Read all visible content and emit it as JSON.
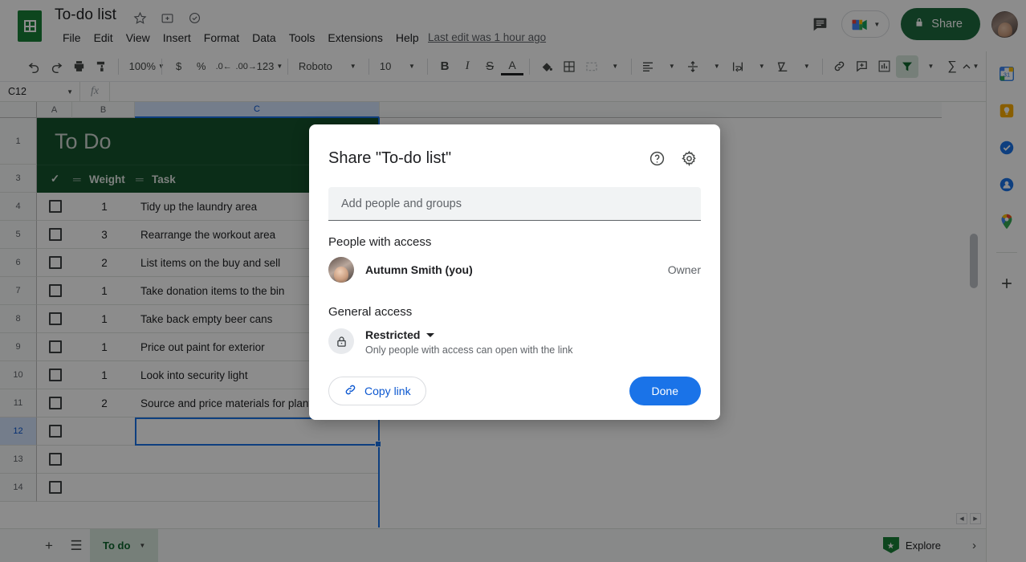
{
  "app": {
    "name": "Google Sheets",
    "doc_title": "To-do list",
    "last_edit": "Last edit was 1 hour ago"
  },
  "title_bar": {
    "icons": [
      {
        "name": "star-icon",
        "glyph": "☆"
      },
      {
        "name": "move-to-folder-icon",
        "glyph": "❐"
      },
      {
        "name": "cloud-saved-icon",
        "glyph": "☁"
      }
    ],
    "menu": [
      "File",
      "Edit",
      "View",
      "Insert",
      "Format",
      "Data",
      "Tools",
      "Extensions",
      "Help"
    ],
    "comment_icon": "comment-history-icon",
    "meet_icon": "google-meet-icon",
    "share_label": "Share",
    "share_color": "#1e6b3f",
    "avatar_name": "account-avatar"
  },
  "toolbar": {
    "zoom": "100%",
    "font": "Roboto",
    "font_size": "10",
    "number_format": "123",
    "items": [
      {
        "name": "undo-icon",
        "glyph": "↶"
      },
      {
        "name": "redo-icon",
        "glyph": "↷"
      },
      {
        "name": "print-icon",
        "glyph": "⎙"
      },
      {
        "name": "paint-format-icon",
        "glyph": "✐"
      },
      {
        "name": "currency-icon",
        "glyph": "$"
      },
      {
        "name": "percent-icon",
        "glyph": "%"
      },
      {
        "name": "decrease-decimal-icon",
        "glyph": ".0"
      },
      {
        "name": "increase-decimal-icon",
        "glyph": ".00"
      },
      {
        "name": "bold-icon",
        "glyph": "B"
      },
      {
        "name": "italic-icon",
        "glyph": "I"
      },
      {
        "name": "strikethrough-icon",
        "glyph": "S"
      },
      {
        "name": "text-color-icon",
        "glyph": "A"
      },
      {
        "name": "fill-color-icon",
        "glyph": "◆"
      },
      {
        "name": "borders-icon",
        "glyph": "⊞"
      },
      {
        "name": "merge-cells-icon",
        "glyph": "⬚"
      },
      {
        "name": "horizontal-align-icon",
        "glyph": "☰"
      },
      {
        "name": "vertical-align-icon",
        "glyph": "⩒"
      },
      {
        "name": "text-wrap-icon",
        "glyph": "↵"
      },
      {
        "name": "text-rotation-icon",
        "glyph": "▽"
      },
      {
        "name": "insert-link-icon",
        "glyph": "⚭"
      },
      {
        "name": "insert-comment-icon",
        "glyph": "⊞"
      },
      {
        "name": "insert-chart-icon",
        "glyph": "Ὄa"
      },
      {
        "name": "filter-icon",
        "glyph": "▼"
      },
      {
        "name": "functions-icon",
        "glyph": "Σ"
      },
      {
        "name": "collapse-toolbar-icon",
        "glyph": "∧"
      }
    ]
  },
  "formula_bar": {
    "cell_reference": "C12",
    "fx_label": "fx",
    "formula_value": ""
  },
  "grid": {
    "columns": [
      "A",
      "B",
      "C"
    ],
    "selected_column": "C",
    "selected_cell": "C12",
    "sheet_header": {
      "title": "To Do",
      "col_check": "✓",
      "col_weight": "Weight",
      "col_task": "Task",
      "background": "#14532d"
    },
    "row_numbers": [
      "1",
      "3",
      "4",
      "5",
      "6",
      "7",
      "8",
      "9",
      "10",
      "11",
      "12",
      "13",
      "14"
    ],
    "rows": [
      {
        "row": "4",
        "checked": false,
        "weight": "1",
        "task": "Tidy up the laundry area"
      },
      {
        "row": "5",
        "checked": false,
        "weight": "3",
        "task": "Rearrange the workout area"
      },
      {
        "row": "6",
        "checked": false,
        "weight": "2",
        "task": "List items on the buy and sell"
      },
      {
        "row": "7",
        "checked": false,
        "weight": "1",
        "task": "Take donation items to the bin"
      },
      {
        "row": "8",
        "checked": false,
        "weight": "1",
        "task": "Take back empty beer cans"
      },
      {
        "row": "9",
        "checked": false,
        "weight": "1",
        "task": "Price out paint for exterior"
      },
      {
        "row": "10",
        "checked": false,
        "weight": "1",
        "task": "Look into security light"
      },
      {
        "row": "11",
        "checked": false,
        "weight": "2",
        "task": "Source and price materials for plant"
      },
      {
        "row": "12",
        "checked": false,
        "weight": "",
        "task": ""
      },
      {
        "row": "13",
        "checked": false,
        "weight": "",
        "task": ""
      },
      {
        "row": "14",
        "checked": false,
        "weight": "",
        "task": ""
      }
    ]
  },
  "sheet_bar": {
    "add_sheet_icon": "+",
    "all_sheets_icon": "☰",
    "tabs": [
      {
        "label": "To do",
        "active": true
      }
    ],
    "explore_label": "Explore",
    "expand_icon": "›"
  },
  "side_panel": {
    "items": [
      {
        "name": "google-calendar-icon",
        "label": "31",
        "color": "#1a73e8"
      },
      {
        "name": "google-keep-icon",
        "label": "",
        "color": "#f9ab00"
      },
      {
        "name": "google-tasks-icon",
        "label": "",
        "color": "#1a73e8"
      },
      {
        "name": "google-contacts-icon",
        "label": "",
        "color": "#1a73e8"
      },
      {
        "name": "google-maps-icon",
        "label": "",
        "color": "#34a853"
      },
      {
        "name": "add-apps-icon",
        "label": "+",
        "color": "#444746"
      }
    ]
  },
  "share_dialog": {
    "title": "Share \"To-do list\"",
    "help_icon": "help-icon",
    "settings_icon": "settings-gear-icon",
    "add_people_placeholder": "Add people and groups",
    "people_section_title": "People with access",
    "people": [
      {
        "name": "Autumn Smith (you)",
        "role": "Owner"
      }
    ],
    "general_access_title": "General access",
    "access_value": "Restricted",
    "access_description": "Only people with access can open with the link",
    "copy_link_label": "Copy link",
    "done_label": "Done",
    "done_color": "#1a73e8"
  }
}
